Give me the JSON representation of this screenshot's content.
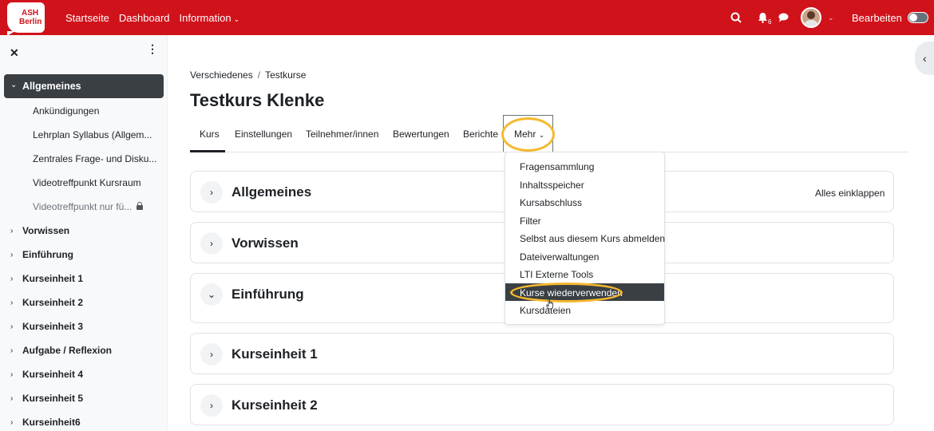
{
  "navbar": {
    "logo_line1": "ASH",
    "logo_line2": "Berlin",
    "links": [
      "Startseite",
      "Dashboard",
      "Information"
    ],
    "notification_count": "6",
    "edit_label": "Bearbeiten",
    "accent": "#d0121b"
  },
  "sidebar": {
    "active_section": "Allgemeines",
    "sub_items": [
      "Ankündigungen",
      "Lehrplan Syllabus (Allgem...",
      "Zentrales Frage- und Disku...",
      "Videotreffpunkt Kursraum",
      "Videotreffpunkt nur fü..."
    ],
    "sections": [
      "Vorwissen",
      "Einführung",
      "Kurseinheit 1",
      "Kurseinheit 2",
      "Kurseinheit 3",
      "Aufgabe / Reflexion",
      "Kurseinheit 4",
      "Kurseinheit 5",
      "Kurseinheit6"
    ]
  },
  "breadcrumb": [
    "Verschiedenes",
    "Testkurse"
  ],
  "page_title": "Testkurs Klenke",
  "tabs": [
    "Kurs",
    "Einstellungen",
    "Teilnehmer/innen",
    "Bewertungen",
    "Berichte",
    "Mehr"
  ],
  "collapse_all": "Alles einklappen",
  "sections": [
    "Allgemeines",
    "Vorwissen",
    "Einführung",
    "Kurseinheit 1",
    "Kurseinheit 2"
  ],
  "dropdown": {
    "items": [
      "Fragensammlung",
      "Inhaltsspeicher",
      "Kursabschluss",
      "Filter",
      "Selbst aus diesem Kurs abmelden",
      "Dateiverwaltungen",
      "LTI Externe Tools",
      "Kurse wiederverwenden",
      "Kursdateien"
    ]
  },
  "highlight_color": "#f5b82e"
}
